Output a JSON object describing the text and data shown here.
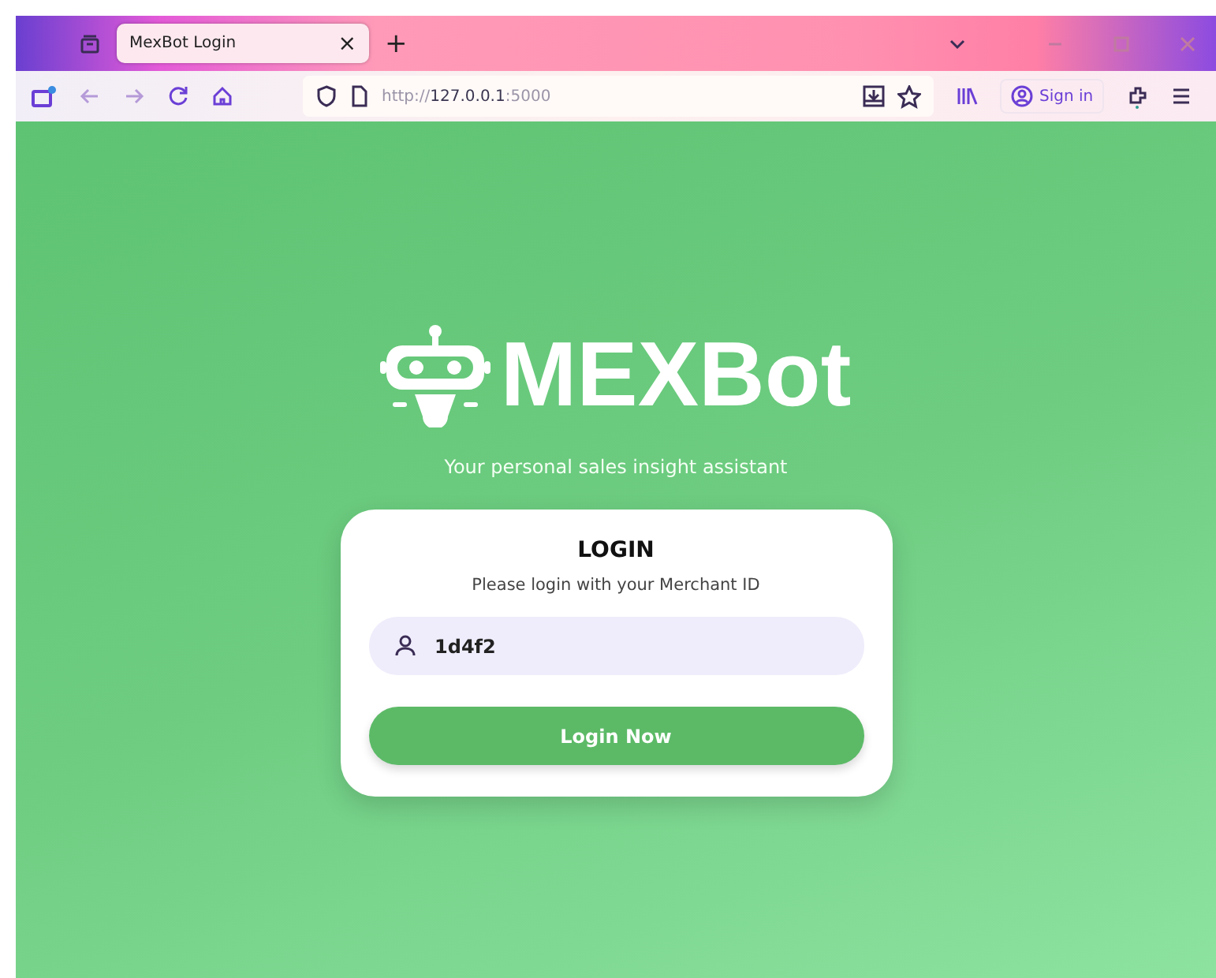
{
  "browser": {
    "tabs": [
      {
        "title": "MexBot Login",
        "selected": true
      }
    ],
    "close_tab": "×",
    "new_tab": "+",
    "url": {
      "scheme": "http://",
      "host": "127.0.0.1",
      "port": ":5000"
    },
    "sign_in": "Sign in"
  },
  "page": {
    "brand": "MEXBot",
    "tagline": "Your personal sales insight assistant",
    "card": {
      "title": "LOGIN",
      "subtitle": "Please login with your Merchant ID",
      "merchant_id": {
        "value": "1d4f2"
      },
      "button": "Login Now"
    }
  }
}
